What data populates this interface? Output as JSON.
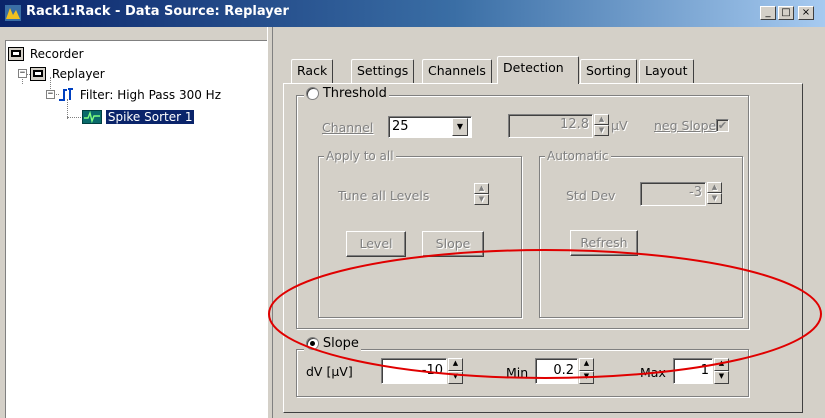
{
  "window": {
    "title": "Rack1:Rack - Data Source: Replayer",
    "minimize_label": "_",
    "maximize_label": "□",
    "close_label": "×"
  },
  "tree": {
    "items": [
      {
        "label": "Recorder",
        "icon": "recorder-icon"
      },
      {
        "label": "Replayer",
        "icon": "replayer-icon",
        "expander": "−"
      },
      {
        "label": "Filter: High Pass 300 Hz",
        "icon": "filter-icon",
        "expander": "−"
      },
      {
        "label": "Spike Sorter 1",
        "icon": "spike-sorter-icon",
        "selected": true
      }
    ]
  },
  "tabs": [
    {
      "label": "Rack"
    },
    {
      "label": "Settings"
    },
    {
      "label": "Channels"
    },
    {
      "label": "Detection",
      "active": true
    },
    {
      "label": "Sorting"
    },
    {
      "label": "Layout"
    }
  ],
  "threshold": {
    "label": "Threshold",
    "channel_label": "Channel",
    "channel_value": "25",
    "level_value": "12.8",
    "unit": "µV",
    "neg_slope_label": "neg Slope",
    "neg_slope_checked": true,
    "apply_all": {
      "legend": "Apply to all",
      "tune_label": "Tune all Levels",
      "level_button": "Level",
      "slope_button": "Slope"
    },
    "automatic": {
      "legend": "Automatic",
      "stddev_label": "Std Dev",
      "stddev_value": "-3",
      "refresh_button": "Refresh"
    }
  },
  "slope": {
    "label": "Slope",
    "selected": true,
    "dv_label": "dV [µV]",
    "dv_value": "-10",
    "min_label": "Min",
    "min_value": "0.2",
    "max_label": "Max",
    "max_value": "1"
  },
  "annotation": {
    "shape": "ellipse",
    "color": "#e00000"
  }
}
